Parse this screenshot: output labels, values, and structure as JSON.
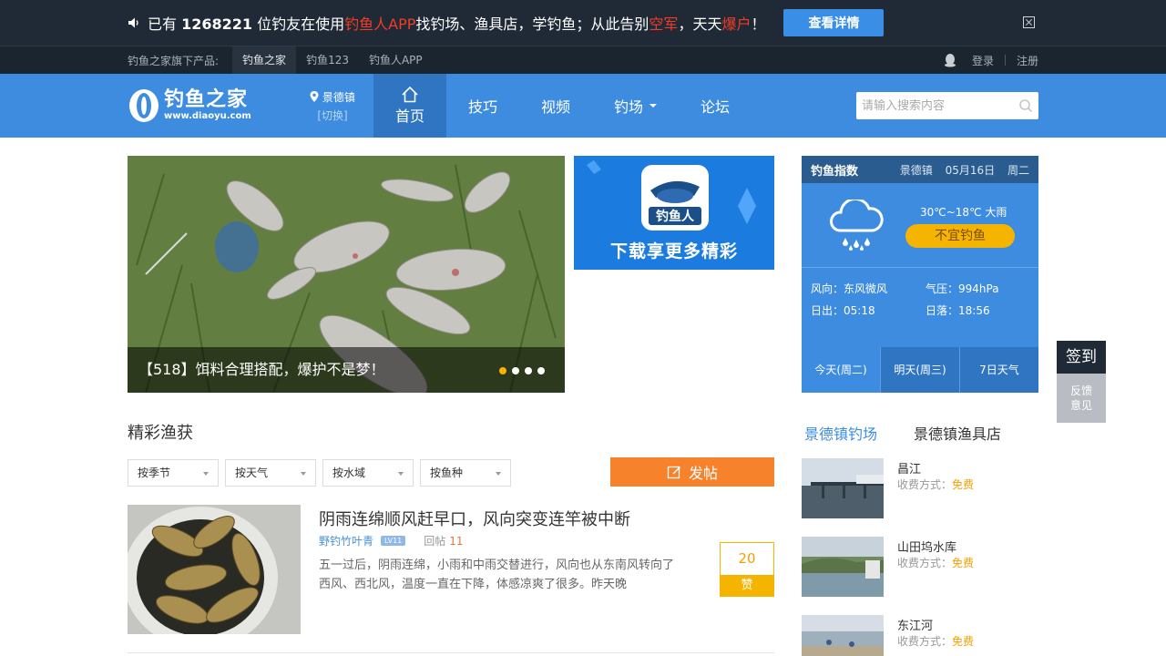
{
  "promo": {
    "part1": "已有",
    "count": "1268221",
    "part2": "位钓友在使用",
    "app": "钓鱼人APP",
    "part3": "找钓场、渔具店，学钓鱼；从此告别",
    "hl1": "空军",
    "part4": "，天天",
    "hl2": "爆户",
    "part5": "！",
    "button": "查看详情"
  },
  "subbar": {
    "label": "钓鱼之家旗下产品:",
    "products": [
      "钓鱼之家",
      "钓鱼123",
      "钓鱼人APP"
    ],
    "login": "登录",
    "register": "注册"
  },
  "nav": {
    "logo_name": "钓鱼之家",
    "logo_url": "www.diaoyu.com",
    "location": "景德镇",
    "switch": "[切换]",
    "items": [
      "首页",
      "技巧",
      "视频",
      "钓场",
      "论坛"
    ],
    "search_placeholder": "请输入搜索内容"
  },
  "hero": {
    "caption": "【518】饵料合理搭配，爆护不是梦！",
    "slides": 4,
    "active_slide": 1
  },
  "app_banner": {
    "app_name": "钓鱼人",
    "tagline": "下载享更多精彩"
  },
  "catch": {
    "title": "精彩渔获",
    "filters": [
      "按季节",
      "按天气",
      "按水域",
      "按鱼种"
    ],
    "post_button": "发帖"
  },
  "post": {
    "title": "阴雨连绵顺风赶早口，风向突变连竿被中断",
    "author": "野钓竹叶青",
    "level": "LV11",
    "reply_label": "回帖",
    "reply_count": "11",
    "excerpt": "五一过后，阴雨连绵，小雨和中雨交替进行，风向也从东南风转向了西风、西北风，温度一直在下降，体感凉爽了很多。昨天晚",
    "likes": "20",
    "like_label": "赞"
  },
  "weather": {
    "title": "钓鱼指数",
    "city": "景德镇",
    "date": "05月16日",
    "weekday": "周二",
    "temp": "30℃~18℃ 大雨",
    "rating": "不宜钓鱼",
    "wind": "风向：东风微风",
    "pressure": "气压：994hPa",
    "sunrise": "日出：05:18",
    "sunset": "日落：18:56",
    "tabs": [
      "今天(周二)",
      "明天(周三)",
      "7日天气"
    ]
  },
  "right_tabs": [
    "景德镇钓场",
    "景德镇渔具店"
  ],
  "spots": [
    {
      "name": "昌江",
      "fee_label": "收费方式：",
      "fee": "免费"
    },
    {
      "name": "山田坞水库",
      "fee_label": "收费方式：",
      "fee": "免费"
    },
    {
      "name": "东江河",
      "fee_label": "收费方式：",
      "fee": "免费"
    }
  ],
  "side": {
    "sign": "签到",
    "feedback1": "反馈",
    "feedback2": "意见"
  },
  "colors": {
    "nav_blue": "#3d8ce0",
    "dark_bar": "#1f2a36",
    "accent_orange": "#f6822b",
    "accent_yellow": "#f5b400",
    "highlight_red": "#f23c25"
  }
}
